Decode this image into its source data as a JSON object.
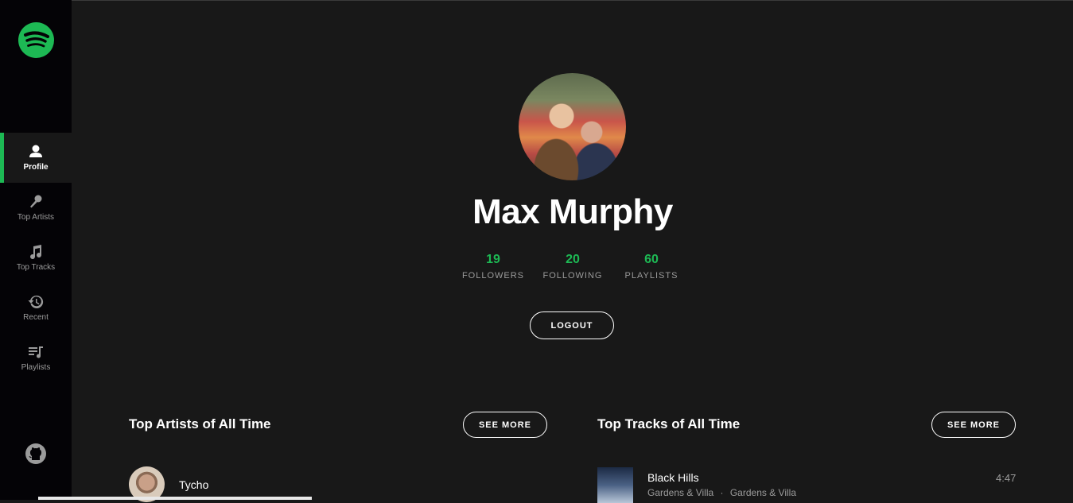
{
  "sidebar": {
    "items": [
      {
        "label": "Profile",
        "icon": "user-icon",
        "active": true
      },
      {
        "label": "Top Artists",
        "icon": "microphone-icon"
      },
      {
        "label": "Top Tracks",
        "icon": "music-note-icon"
      },
      {
        "label": "Recent",
        "icon": "history-icon"
      },
      {
        "label": "Playlists",
        "icon": "playlist-icon"
      }
    ]
  },
  "profile": {
    "name": "Max Murphy",
    "stats": [
      {
        "value": "19",
        "label": "FOLLOWERS"
      },
      {
        "value": "20",
        "label": "FOLLOWING"
      },
      {
        "value": "60",
        "label": "PLAYLISTS"
      }
    ],
    "logout_label": "LOGOUT"
  },
  "top_artists": {
    "title": "Top Artists of All Time",
    "see_more_label": "SEE MORE",
    "items": [
      {
        "name": "Tycho"
      }
    ]
  },
  "top_tracks": {
    "title": "Top Tracks of All Time",
    "see_more_label": "SEE MORE",
    "items": [
      {
        "title": "Black Hills",
        "artist": "Gardens & Villa",
        "separator": "·",
        "album": "Gardens & Villa",
        "duration": "4:47"
      }
    ]
  },
  "colors": {
    "accent": "#1db954",
    "background": "#181818",
    "sidebar": "#040306",
    "muted": "#9b9b9b"
  }
}
